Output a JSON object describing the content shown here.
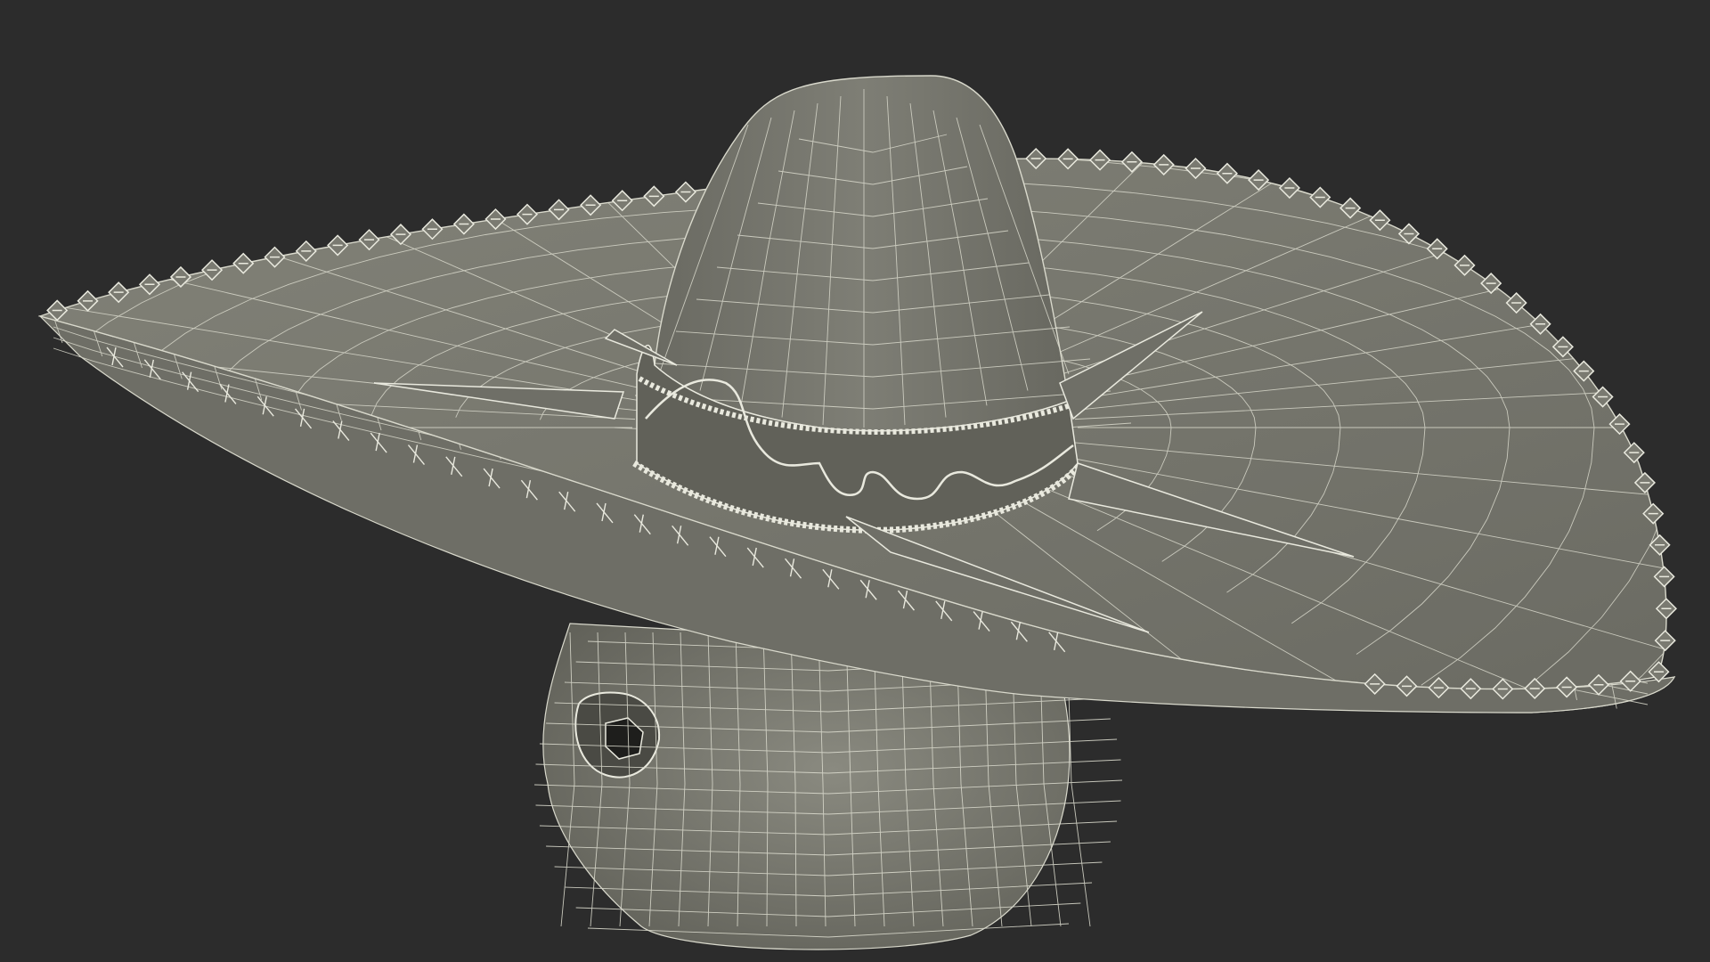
{
  "scene": {
    "subject": "sombrero-on-skull-wireframe",
    "colors": {
      "background": "#2c2c2c",
      "surface": "#74746b",
      "surface_dark": "#5f5f57",
      "surface_light": "#8a8a80",
      "wire": "#d9d9cc",
      "wire_faint": "#b9b9ad",
      "trim": "#e9e9de",
      "shadow": "#4a4a44"
    }
  }
}
